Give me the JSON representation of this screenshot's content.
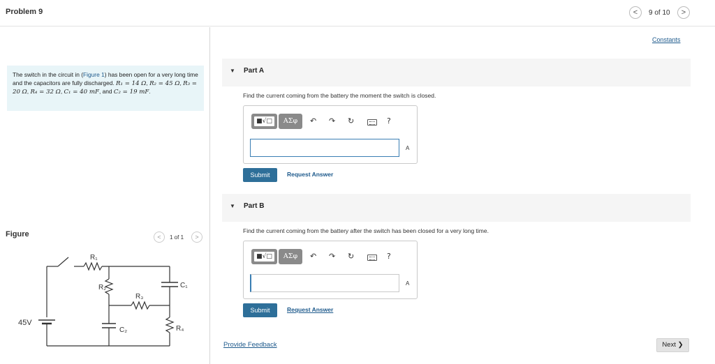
{
  "header": {
    "title": "Problem 9",
    "prev_icon": "chevron-left-icon",
    "next_icon": "chevron-right-icon",
    "page_count": "9 of 10"
  },
  "intro": {
    "text_1": "The switch in the circuit in (",
    "figure_link": "Figure 1",
    "text_2": ") has been open for a very long time and the capacitors are fully discharged. ",
    "r1": "R₁ = 14 Ω",
    "r2": "R₂ = 45 Ω",
    "r3": "R₃ = 20 Ω",
    "r4": "R₄ = 32 Ω",
    "c1": "C₁ = 40 mF",
    "and": "and",
    "c2": "C₂ = 19 mF"
  },
  "figure": {
    "label": "Figure",
    "count": "1 of 1",
    "labels": {
      "r1": "R₁",
      "r2": "R₂",
      "r3": "R₃",
      "r4": "R₄",
      "c1": "C₁",
      "c2": "C₂",
      "battery": "45V"
    }
  },
  "constants_link": "Constants",
  "toolbar": {
    "template_button": "■√□",
    "symbols_button": "ΑΣφ",
    "undo": "↶",
    "redo": "↷",
    "reset": "↻",
    "help": "?"
  },
  "part_a": {
    "label": "Part A",
    "question": "Find the current coming from the battery the moment the switch is closed.",
    "answer_value": "",
    "unit": "A",
    "submit": "Submit",
    "request_answer": "Request Answer"
  },
  "part_b": {
    "label": "Part B",
    "question": "Find the current coming from the battery after the switch has been closed for a very long time.",
    "answer_value": "",
    "unit": "A",
    "submit": "Submit",
    "request_answer": "Request Answer"
  },
  "footer": {
    "feedback": "Provide Feedback",
    "next": "Next ❯"
  }
}
